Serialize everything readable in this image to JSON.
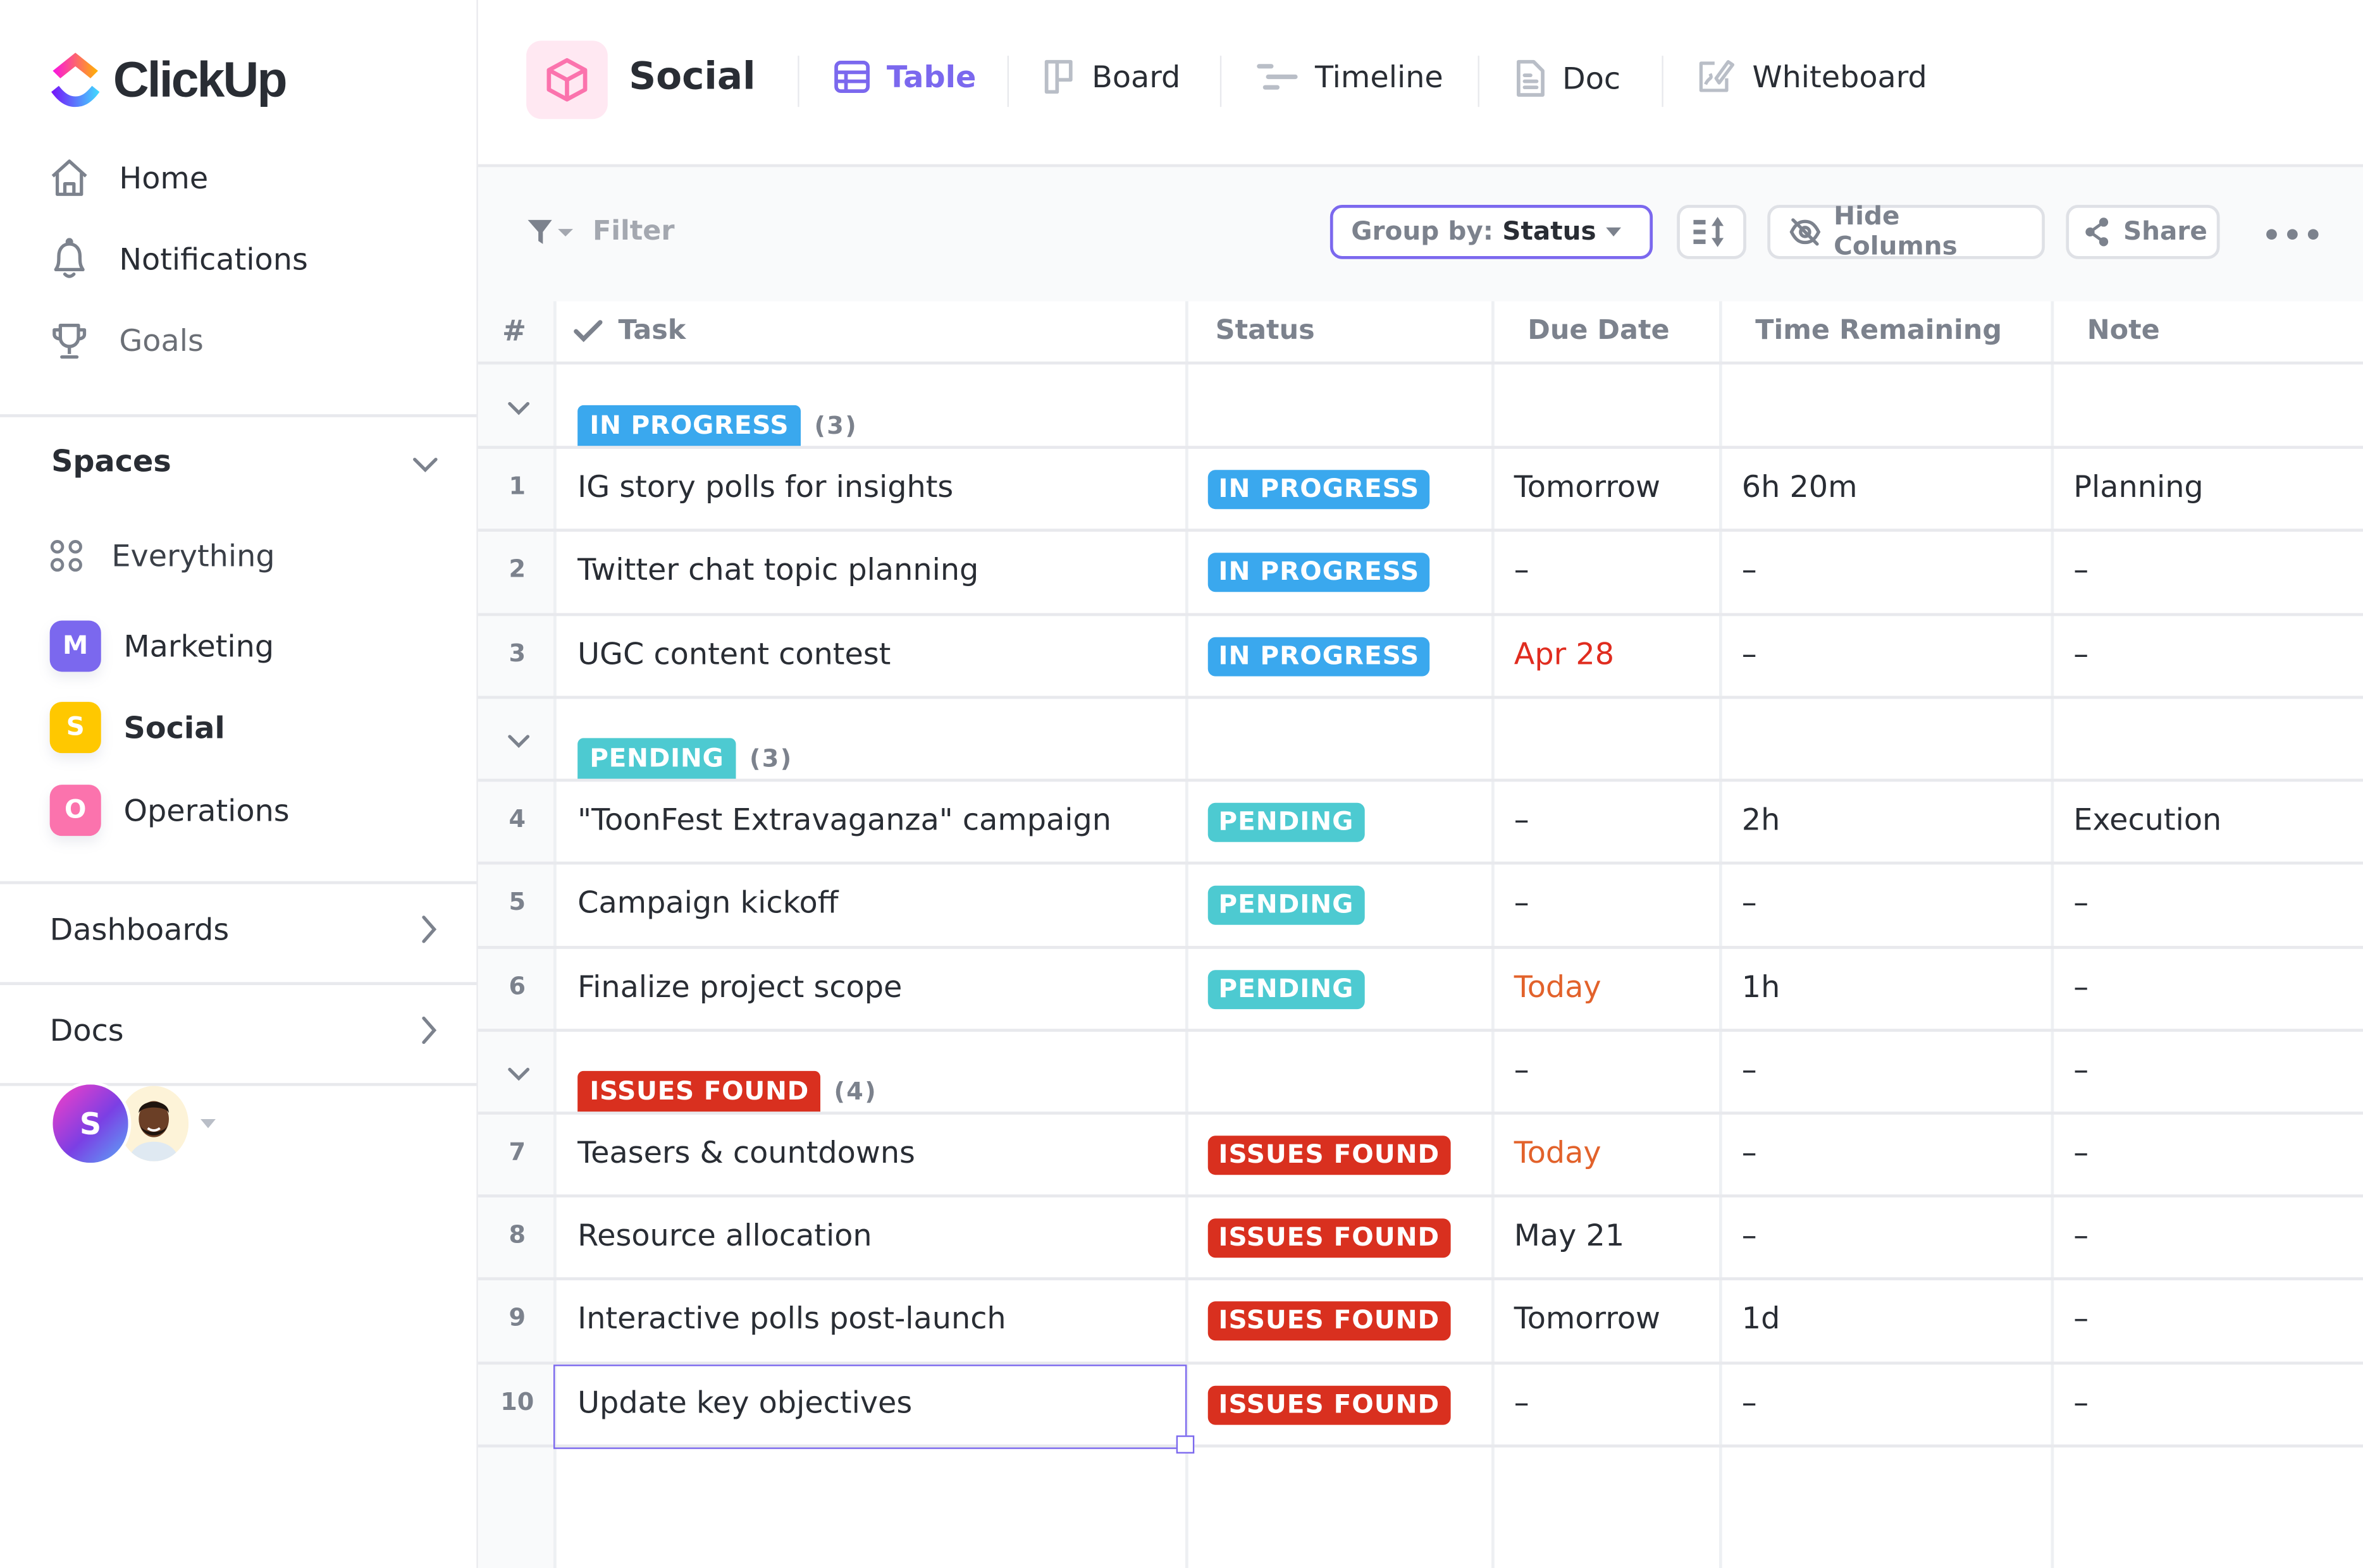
{
  "app": {
    "brand": "ClickUp",
    "colors": {
      "accent": "#7b68ee",
      "in_progress": "#3aa8ee",
      "pending": "#4dcad1",
      "issues_found": "#d9301f",
      "date_overdue": "#e02c1f",
      "date_today": "#e2622b",
      "marketing": "#7b68ee",
      "social": "#ffc800",
      "operations": "#fb73ad"
    }
  },
  "sidebar": {
    "nav": [
      {
        "label": "Home",
        "icon": "home-icon"
      },
      {
        "label": "Notifications",
        "icon": "bell-icon"
      },
      {
        "label": "Goals",
        "icon": "trophy-icon"
      }
    ],
    "spaces_title": "Spaces",
    "everything_label": "Everything",
    "spaces": [
      {
        "letter": "M",
        "label": "Marketing",
        "color": "#7b68ee",
        "active": false
      },
      {
        "letter": "S",
        "label": "Social",
        "color": "#ffc800",
        "active": true
      },
      {
        "letter": "O",
        "label": "Operations",
        "color": "#fb73ad",
        "active": false
      }
    ],
    "dashboards_label": "Dashboards",
    "docs_label": "Docs",
    "avatar_letter": "S"
  },
  "header": {
    "space_title": "Social",
    "views": [
      {
        "label": "Table",
        "icon": "table-icon",
        "active": true
      },
      {
        "label": "Board",
        "icon": "board-icon",
        "active": false
      },
      {
        "label": "Timeline",
        "icon": "timeline-icon",
        "active": false
      },
      {
        "label": "Doc",
        "icon": "doc-icon",
        "active": false
      },
      {
        "label": "Whiteboard",
        "icon": "whiteboard-icon",
        "active": false
      }
    ]
  },
  "toolbar": {
    "filter_label": "Filter",
    "group_by_label": "Group by:",
    "group_by_value": "Status",
    "hide_columns_label": "Hide Columns",
    "share_label": "Share",
    "more_label": "•••"
  },
  "table": {
    "columns": [
      "#",
      "Task",
      "Status",
      "Due Date",
      "Time Remaining",
      "Note"
    ],
    "groups": [
      {
        "status": "IN PROGRESS",
        "count": "(3)",
        "color": "#3aa8ee",
        "summary": {
          "due": "",
          "time": "",
          "note": ""
        },
        "rows": [
          {
            "num": "1",
            "task": "IG story polls for insights",
            "status": "IN PROGRESS",
            "due": "Tomorrow",
            "due_tone": "normal",
            "time": "6h 20m",
            "note": "Planning"
          },
          {
            "num": "2",
            "task": "Twitter chat topic planning",
            "status": "IN PROGRESS",
            "due": "–",
            "due_tone": "normal",
            "time": "–",
            "note": "–"
          },
          {
            "num": "3",
            "task": "UGC content contest",
            "status": "IN PROGRESS",
            "due": "Apr 28",
            "due_tone": "overdue",
            "time": "–",
            "note": "–"
          }
        ]
      },
      {
        "status": "PENDING",
        "count": "(3)",
        "color": "#4dcad1",
        "summary": {
          "due": "",
          "time": "",
          "note": ""
        },
        "rows": [
          {
            "num": "4",
            "task": "\"ToonFest Extravaganza\" campaign",
            "status": "PENDING",
            "due": "–",
            "due_tone": "normal",
            "time": "2h",
            "note": "Execution"
          },
          {
            "num": "5",
            "task": "Campaign kickoff",
            "status": "PENDING",
            "due": "–",
            "due_tone": "normal",
            "time": "–",
            "note": "–"
          },
          {
            "num": "6",
            "task": "Finalize project scope",
            "status": "PENDING",
            "due": "Today",
            "due_tone": "today",
            "time": "1h",
            "note": "–"
          }
        ]
      },
      {
        "status": "ISSUES FOUND",
        "count": "(4)",
        "color": "#d9301f",
        "summary": {
          "due": "–",
          "time": "–",
          "note": "–"
        },
        "rows": [
          {
            "num": "7",
            "task": "Teasers & countdowns",
            "status": "ISSUES FOUND",
            "due": "Today",
            "due_tone": "today",
            "time": "–",
            "note": "–"
          },
          {
            "num": "8",
            "task": "Resource allocation",
            "status": "ISSUES FOUND",
            "due": "May 21",
            "due_tone": "normal",
            "time": "–",
            "note": "–"
          },
          {
            "num": "9",
            "task": "Interactive polls post-launch",
            "status": "ISSUES FOUND",
            "due": "Tomorrow",
            "due_tone": "normal",
            "time": "1d",
            "note": "–"
          },
          {
            "num": "10",
            "task": "Update key objectives",
            "status": "ISSUES FOUND",
            "due": "–",
            "due_tone": "normal",
            "time": "–",
            "note": "–",
            "selected": true
          }
        ]
      }
    ]
  }
}
